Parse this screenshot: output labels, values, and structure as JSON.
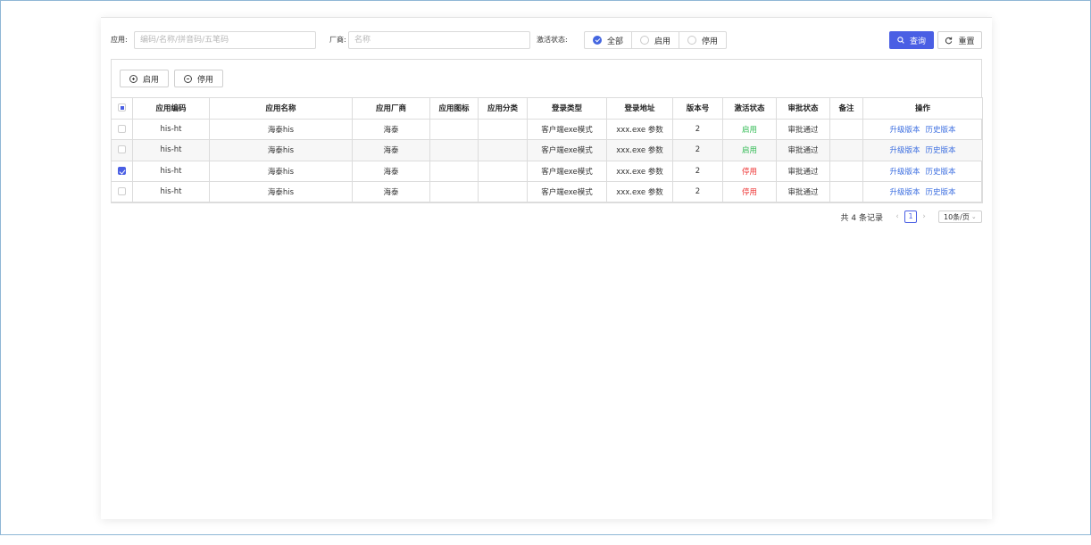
{
  "filter": {
    "app_label": "应用:",
    "app_placeholder": "编码/名称/拼音码/五笔码",
    "vendor_label": "厂商:",
    "vendor_placeholder": "名称",
    "status_label": "激活状态:",
    "status_options": [
      "全部",
      "启用",
      "停用"
    ],
    "query_label": "查询",
    "reset_label": "重置"
  },
  "toolbar": {
    "enable_label": "启用",
    "disable_label": "停用"
  },
  "table": {
    "columns": [
      "应用编码",
      "应用名称",
      "应用厂商",
      "应用图标",
      "应用分类",
      "登录类型",
      "登录地址",
      "版本号",
      "激活状态",
      "审批状态",
      "备注",
      "操作"
    ],
    "rows": [
      {
        "code": "his-ht",
        "name": "海泰his",
        "vendor": "海泰",
        "icon": "",
        "category": "",
        "login_type": "客户端exe模式",
        "login_addr": "xxx.exe 参数",
        "version": "2",
        "status": "启用",
        "approval": "审批通过",
        "remark": "",
        "op_upgrade": "升级版本",
        "op_history": "历史版本"
      },
      {
        "code": "his-ht",
        "name": "海泰his",
        "vendor": "海泰",
        "icon": "",
        "category": "",
        "login_type": "客户端exe模式",
        "login_addr": "xxx.exe 参数",
        "version": "2",
        "status": "启用",
        "approval": "审批通过",
        "remark": "",
        "op_upgrade": "升级版本",
        "op_history": "历史版本"
      },
      {
        "code": "his-ht",
        "name": "海泰his",
        "vendor": "海泰",
        "icon": "",
        "category": "",
        "login_type": "客户端exe模式",
        "login_addr": "xxx.exe 参数",
        "version": "2",
        "status": "停用",
        "approval": "审批通过",
        "remark": "",
        "op_upgrade": "升级版本",
        "op_history": "历史版本"
      },
      {
        "code": "his-ht",
        "name": "海泰his",
        "vendor": "海泰",
        "icon": "",
        "category": "",
        "login_type": "客户端exe模式",
        "login_addr": "xxx.exe 参数",
        "version": "2",
        "status": "停用",
        "approval": "审批通过",
        "remark": "",
        "op_upgrade": "升级版本",
        "op_history": "历史版本"
      }
    ]
  },
  "pagination": {
    "total_text": "共 4 条记录",
    "current_page": "1",
    "page_size": "10条/页"
  },
  "colors": {
    "primary": "#4a5fe4",
    "enabled": "#33bb55",
    "disabled": "#ee3333",
    "link": "#3d6fe0"
  }
}
